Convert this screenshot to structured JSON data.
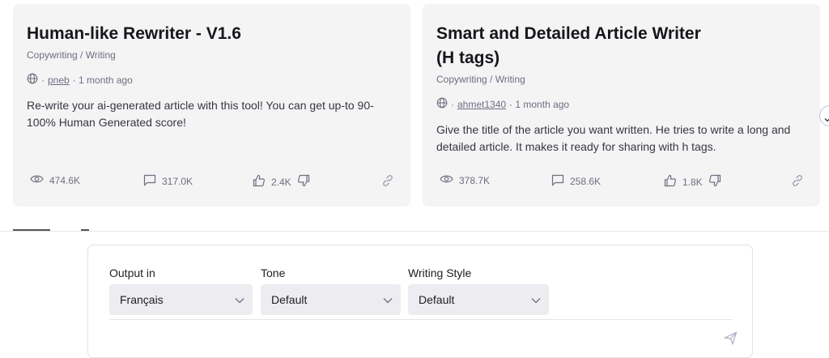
{
  "cards": [
    {
      "title": "Human-like Rewriter - V1.6",
      "category": "Copywriting / Writing",
      "separator": "·",
      "author": "pneb",
      "time": "· 1 month ago",
      "description": "Re-write your ai-generated article with this tool! You can get up-to 90-100% Human Generated score!",
      "views": "474.6K",
      "comments": "317.0K",
      "likes": "2.4K"
    },
    {
      "title": "Smart and Detailed Article Writer (H tags)",
      "category": "Copywriting / Writing",
      "separator": "·",
      "author": "ahmet1340",
      "time": "· 1 month ago",
      "description": "Give the title of the article you want written. He tries to write a long and detailed article. It makes it ready for sharing with h tags.",
      "views": "378.7K",
      "comments": "258.6K",
      "likes": "1.8K"
    }
  ],
  "settings": {
    "output": {
      "label": "Output in",
      "value": "Français"
    },
    "tone": {
      "label": "Tone",
      "value": "Default"
    },
    "style": {
      "label": "Writing Style",
      "value": "Default"
    }
  },
  "icons": {
    "globe": "globe-icon",
    "eye": "eye-icon",
    "comment": "comment-icon",
    "thumbs_up": "thumbs-up-icon",
    "thumbs_down": "thumbs-down-icon",
    "link": "link-icon",
    "chevron": "chevron-down-icon",
    "send": "send-icon"
  },
  "colors": {
    "card_bg": "#f4f4f5",
    "select_bg": "#ececf1",
    "muted_text": "#6e6e80"
  }
}
